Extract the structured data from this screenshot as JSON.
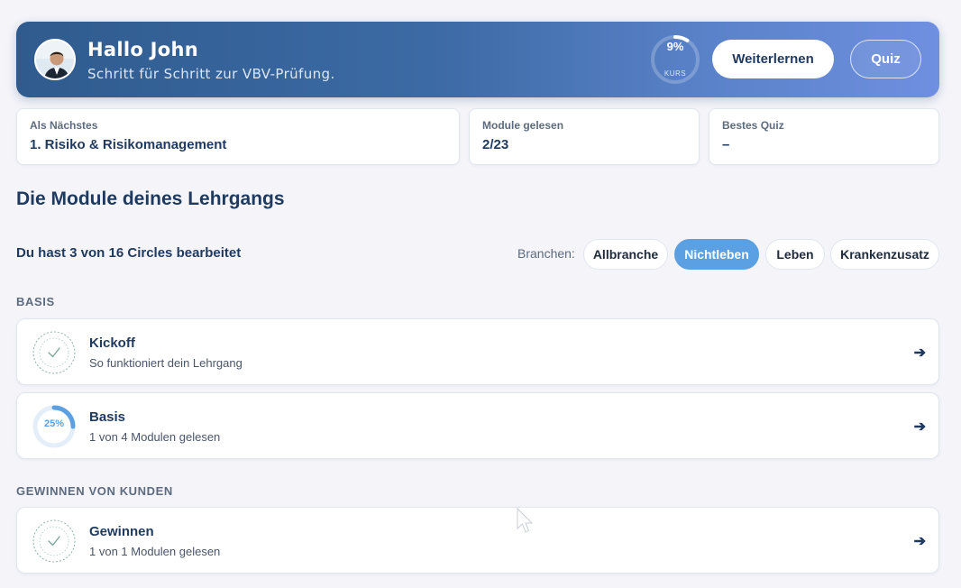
{
  "header": {
    "greeting": "Hallo John",
    "subtitle": "Schritt für Schritt zur VBV-Prüfung.",
    "progress_value": "9%",
    "progress_fraction": 0.09,
    "progress_caption": "KURS",
    "primary_button": "Weiterlernen",
    "secondary_button": "Quiz"
  },
  "stats": [
    {
      "label": "Als Nächstes",
      "value": "1. Risiko & Risikomanagement"
    },
    {
      "label": "Module gelesen",
      "value": "2/23"
    },
    {
      "label": "Bestes Quiz",
      "value": "–"
    }
  ],
  "section_title": "Die Module deines Lehrgangs",
  "circles_summary": "Du hast 3 von 16 Circles bearbeitet",
  "branchen": {
    "label": "Branchen:",
    "options": [
      "Allbranche",
      "Nichtleben",
      "Leben",
      "Krankenzusatz"
    ],
    "selected": "Nichtleben"
  },
  "groups": [
    {
      "label": "BASIS",
      "items": [
        {
          "title": "Kickoff",
          "subtitle": "So funktioniert dein Lehrgang",
          "status": "check-icon"
        },
        {
          "title": "Basis",
          "subtitle": "1 von 4 Modulen gelesen",
          "progress": "25%",
          "progress_fraction": 0.25
        }
      ]
    },
    {
      "label": "GEWINNEN VON KUNDEN",
      "items": [
        {
          "title": "Gewinnen",
          "subtitle": "1 von 1 Modulen gelesen",
          "status": "check-icon"
        }
      ]
    }
  ],
  "colors": {
    "accent": "#5aa0e2",
    "navy": "#1f3a5f",
    "banner_start": "#2f5b8e",
    "banner_end": "#6f8fe0"
  }
}
